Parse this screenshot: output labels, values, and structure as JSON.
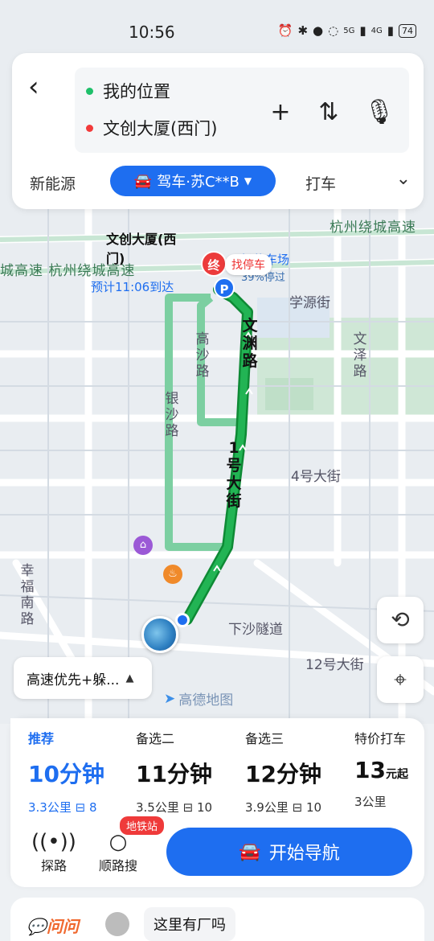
{
  "status_bar": {
    "time": "10:56",
    "icons": [
      "alarm-icon",
      "bluetooth-icon",
      "location-icon",
      "mute-icon",
      "5g-icon",
      "signal-icon",
      "4g-icon",
      "signal-icon",
      "battery-icon"
    ],
    "net1": "5G",
    "net2": "4G",
    "battery": "74"
  },
  "search": {
    "from": "我的位置",
    "to": "文创大厦(西门)"
  },
  "modes": {
    "ev": "新能源",
    "drive": "驾车·苏C**B",
    "taxi": "打车"
  },
  "map": {
    "ring_road_right": "杭州绕城高速",
    "ring_road_left": "城高速  杭州绕城高速",
    "destination": "文创大厦(西门)",
    "eta": "预计11:06到达",
    "parking_name": "场停车场",
    "parking_rate": "39%停过",
    "find_car": "找停车",
    "end_pin": "终",
    "parking_pin": "P",
    "streets": {
      "xueyuan": "学源街",
      "wenze": "文泽路",
      "gaosha": "高沙路",
      "yinsha": "银沙路",
      "wenyuan": "文渊路",
      "no1": "1号大街",
      "no4": "4号大街",
      "xingfu": "幸福南路",
      "xiasha": "下沙隧道",
      "no12": "12号大街"
    },
    "amap_logo": "高德地图",
    "route_preference": "高速优先+躲..."
  },
  "routes": [
    {
      "name": "推荐",
      "time": "10分钟",
      "distance": "3.3公里",
      "lights": "8",
      "selected": true
    },
    {
      "name": "备选二",
      "time": "11分钟",
      "distance": "3.5公里",
      "lights": "10",
      "selected": false
    },
    {
      "name": "备选三",
      "time": "12分钟",
      "distance": "3.9公里",
      "lights": "10",
      "selected": false
    },
    {
      "name": "特价打车",
      "price": "13",
      "price_unit": "元起",
      "distance": "3公里",
      "selected": false
    }
  ],
  "tools": {
    "explore": "探路",
    "search_along": "顺路搜",
    "subway_badge": "地铁站",
    "start_nav": "开始导航"
  },
  "ask": {
    "logo": "问问",
    "prompt": "这里有厂吗"
  },
  "colors": {
    "accent": "#1e6ef0",
    "route_green": "#1fae4a",
    "alt_route": "#7ccfa1",
    "destination_red": "#ec3b3b"
  }
}
